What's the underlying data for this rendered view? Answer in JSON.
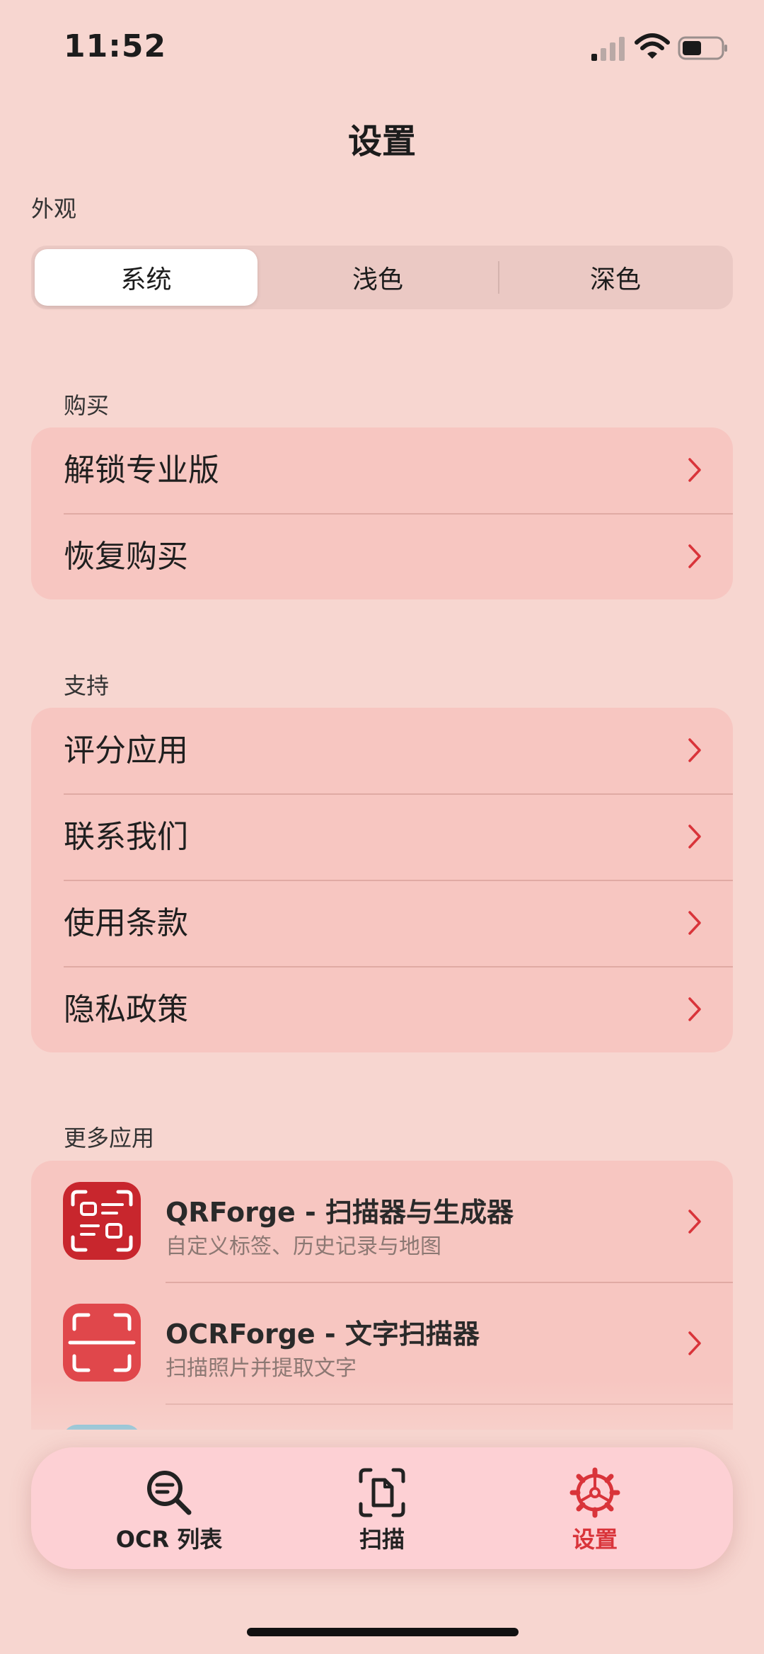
{
  "status_bar": {
    "time": "11:52",
    "icons": [
      "signal-icon",
      "wifi-icon",
      "battery-icon"
    ]
  },
  "header": {
    "title": "设置"
  },
  "appearance": {
    "label": "外观",
    "options": [
      "系统",
      "浅色",
      "深色"
    ],
    "selected": "系统"
  },
  "purchase": {
    "label": "购买",
    "items": [
      {
        "label": "解锁专业版"
      },
      {
        "label": "恢复购买"
      }
    ]
  },
  "support": {
    "label": "支持",
    "items": [
      {
        "label": "评分应用"
      },
      {
        "label": "联系我们"
      },
      {
        "label": "使用条款"
      },
      {
        "label": "隐私政策"
      }
    ]
  },
  "more_apps": {
    "label": "更多应用",
    "items": [
      {
        "title": "QRForge - 扫描器与生成器",
        "subtitle": "自定义标签、历史记录与地图",
        "icon": "qr-code-app-icon"
      },
      {
        "title": "OCRForge - 文字扫描器",
        "subtitle": "扫描照片并提取文字",
        "icon": "text-scanner-app-icon"
      }
    ]
  },
  "tabbar": {
    "tabs": [
      {
        "label": "OCR 列表",
        "icon": "search-text-icon"
      },
      {
        "label": "扫描",
        "icon": "document-scan-icon"
      },
      {
        "label": "设置",
        "icon": "gear-icon"
      }
    ],
    "active": "设置"
  },
  "colors": {
    "accent": "#D9343A",
    "background": "#F7D6D0",
    "card": "#F7C6C1"
  }
}
